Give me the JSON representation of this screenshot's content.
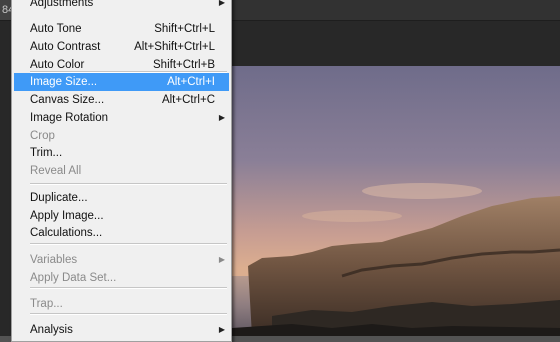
{
  "tab": {
    "label": "84"
  },
  "menu": {
    "items": [
      {
        "label": "Adjustments",
        "shortcut": "",
        "submenu": true,
        "disabled": false
      },
      {
        "label": "Auto Tone",
        "shortcut": "Shift+Ctrl+L",
        "submenu": false,
        "disabled": false
      },
      {
        "label": "Auto Contrast",
        "shortcut": "Alt+Shift+Ctrl+L",
        "submenu": false,
        "disabled": false
      },
      {
        "label": "Auto Color",
        "shortcut": "Shift+Ctrl+B",
        "submenu": false,
        "disabled": false
      },
      {
        "label": "Image Size...",
        "shortcut": "Alt+Ctrl+I",
        "submenu": false,
        "disabled": false,
        "highlighted": true
      },
      {
        "label": "Canvas Size...",
        "shortcut": "Alt+Ctrl+C",
        "submenu": false,
        "disabled": false
      },
      {
        "label": "Image Rotation",
        "shortcut": "",
        "submenu": true,
        "disabled": false
      },
      {
        "label": "Crop",
        "shortcut": "",
        "submenu": false,
        "disabled": true
      },
      {
        "label": "Trim...",
        "shortcut": "",
        "submenu": false,
        "disabled": false
      },
      {
        "label": "Reveal All",
        "shortcut": "",
        "submenu": false,
        "disabled": true
      },
      {
        "label": "Duplicate...",
        "shortcut": "",
        "submenu": false,
        "disabled": false
      },
      {
        "label": "Apply Image...",
        "shortcut": "",
        "submenu": false,
        "disabled": false
      },
      {
        "label": "Calculations...",
        "shortcut": "",
        "submenu": false,
        "disabled": false
      },
      {
        "label": "Variables",
        "shortcut": "",
        "submenu": true,
        "disabled": true
      },
      {
        "label": "Apply Data Set...",
        "shortcut": "",
        "submenu": false,
        "disabled": true
      },
      {
        "label": "Trap...",
        "shortcut": "",
        "submenu": false,
        "disabled": true
      },
      {
        "label": "Analysis",
        "shortcut": "",
        "submenu": true,
        "disabled": false
      }
    ]
  },
  "colors": {
    "highlight": "#3f9af7",
    "menu_bg": "#f0f0f0",
    "disabled_text": "#8a8a8a"
  }
}
